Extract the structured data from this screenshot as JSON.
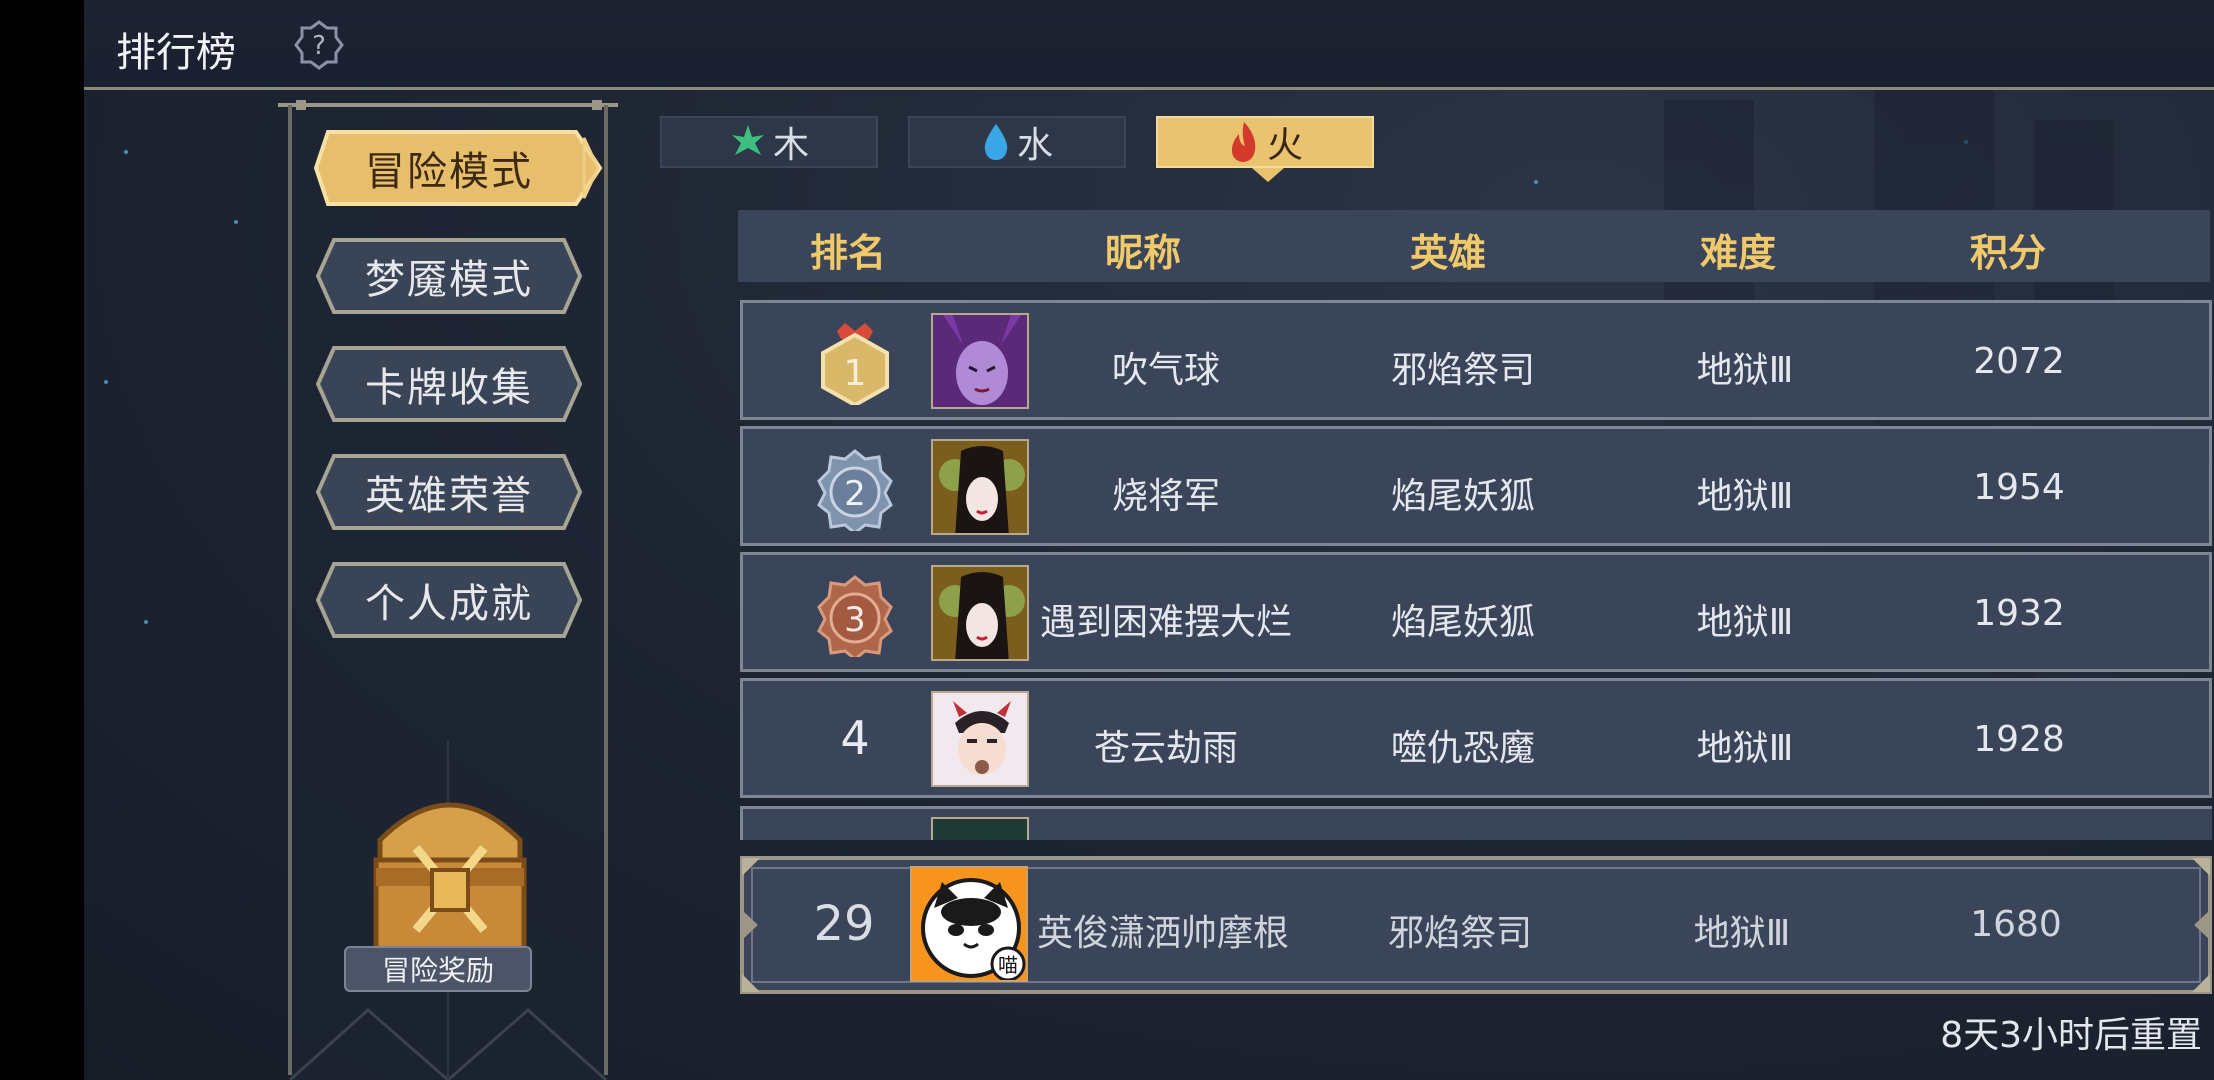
{
  "header": {
    "title": "排行榜",
    "help_icon": "question-icon"
  },
  "sidebar": {
    "items": [
      {
        "label": "冒险模式",
        "active": true
      },
      {
        "label": "梦魇模式",
        "active": false
      },
      {
        "label": "卡牌收集",
        "active": false
      },
      {
        "label": "英雄荣誉",
        "active": false
      },
      {
        "label": "个人成就",
        "active": false
      }
    ],
    "reward_label": "冒险奖励",
    "reward_icon": "treasure-chest-icon"
  },
  "element_tabs": [
    {
      "label": "木",
      "icon": "leaf-icon",
      "color": "#3fbf7f",
      "active": false
    },
    {
      "label": "水",
      "icon": "water-drop-icon",
      "color": "#3aa6e6",
      "active": false
    },
    {
      "label": "火",
      "icon": "fire-icon",
      "color": "#d33a2c",
      "active": true
    }
  ],
  "table": {
    "columns": [
      "排名",
      "昵称",
      "英雄",
      "难度",
      "积分"
    ],
    "rows": [
      {
        "rank": "1",
        "nickname": "吹气球",
        "hero": "邪焰祭司",
        "difficulty": "地狱Ⅲ",
        "score": "2072"
      },
      {
        "rank": "2",
        "nickname": "烧将军",
        "hero": "焰尾妖狐",
        "difficulty": "地狱Ⅲ",
        "score": "1954"
      },
      {
        "rank": "3",
        "nickname": "遇到困难摆大烂",
        "hero": "焰尾妖狐",
        "difficulty": "地狱Ⅲ",
        "score": "1932"
      },
      {
        "rank": "4",
        "nickname": "苍云劫雨",
        "hero": "噬仇恐魔",
        "difficulty": "地狱Ⅲ",
        "score": "1928"
      }
    ],
    "self_row": {
      "rank": "29",
      "nickname": "英俊潇洒帅摩根",
      "hero": "邪焰祭司",
      "difficulty": "地狱Ⅲ",
      "score": "1680",
      "avatar_badge": "喵"
    }
  },
  "reset_text": "8天3小时后重置",
  "colors": {
    "accent_gold": "#f0c96a",
    "panel": "#3a4559",
    "active_tab": "#e9c370"
  }
}
